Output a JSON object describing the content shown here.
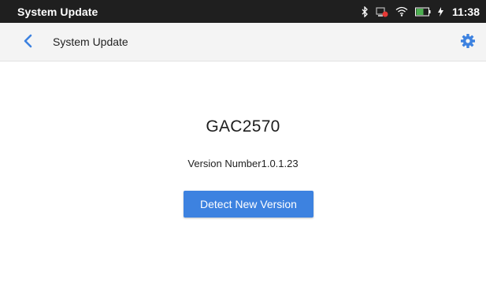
{
  "status_bar": {
    "title": "System Update",
    "battery_level": "50%",
    "time": "11:38"
  },
  "app_bar": {
    "title": "System Update"
  },
  "main": {
    "model": "GAC2570",
    "version_text": "Version Number1.0.1.23",
    "detect_button_label": "Detect New Version"
  },
  "colors": {
    "status_bar_bg": "#1f1f1f",
    "app_bar_bg": "#f4f4f4",
    "accent": "#3d82e0",
    "battery_green": "#4caf50"
  },
  "icons": [
    "bluetooth-icon",
    "network-icon",
    "wifi-icon",
    "battery-icon",
    "charging-icon",
    "back-arrow-icon",
    "gear-icon"
  ]
}
